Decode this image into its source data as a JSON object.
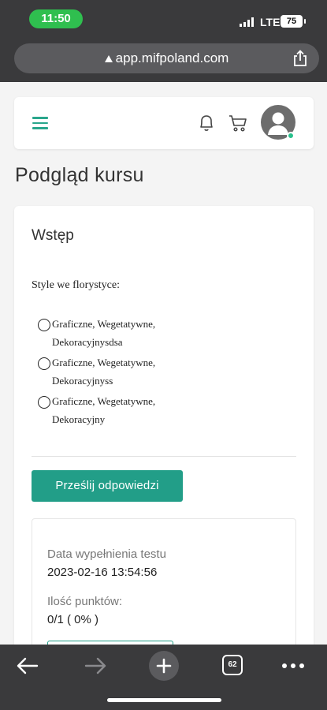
{
  "status_bar": {
    "time": "11:50",
    "network": "LTE",
    "battery": "75"
  },
  "browser": {
    "url": "app.mifpoland.com",
    "tab_count": "62"
  },
  "page": {
    "title": "Podgląd kursu"
  },
  "lesson": {
    "section_title": "Wstęp",
    "question": "Style we florystyce:",
    "options": [
      {
        "line1": "Graficzne, Wegetatywne,",
        "line2": "Dekoracyjnysdsa"
      },
      {
        "line1": "Graficzne, Wegetatywne,",
        "line2": "Dekoracyjnyss"
      },
      {
        "line1": "Graficzne, Wegetatywne,",
        "line2": "Dekoracyjny"
      }
    ],
    "submit_label": "Prześlij odpowiedzi"
  },
  "result": {
    "date_label": "Data wypełnienia testu",
    "date_value": "2023-02-16 13:54:56",
    "points_label": "Ilość punktów:",
    "points_value": "0/1 ( 0% )"
  },
  "colors": {
    "accent": "#229e88",
    "status_green": "#2fbf4f",
    "browser_chrome": "#3a3a3c"
  }
}
